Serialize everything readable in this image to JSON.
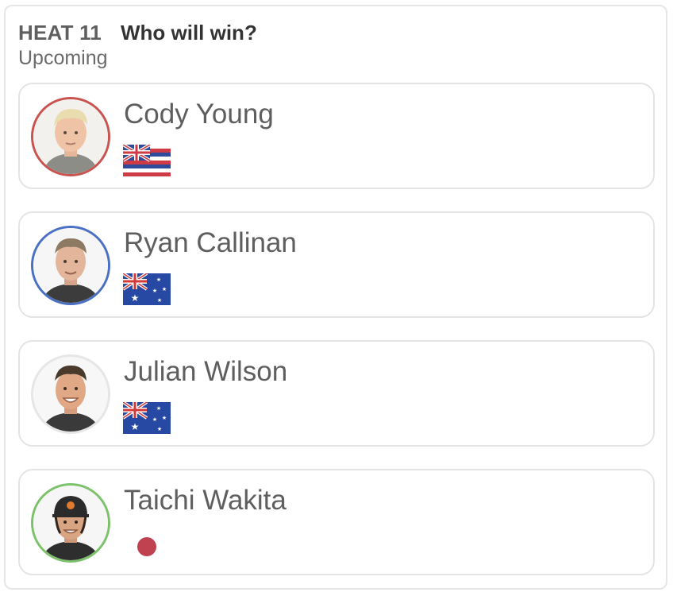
{
  "header": {
    "heat": "HEAT 11",
    "question": "Who will win?",
    "status": "Upcoming"
  },
  "surfers": [
    {
      "name": "Cody Young",
      "flag": "hawaii-flag",
      "ring_color": "#c9534f"
    },
    {
      "name": "Ryan Callinan",
      "flag": "australia-flag",
      "ring_color": "#4a70c4"
    },
    {
      "name": "Julian Wilson",
      "flag": "australia-flag",
      "ring_color": "#e6e6e6"
    },
    {
      "name": "Taichi Wakita",
      "flag": "japan-flag",
      "ring_color": "#7cc26a"
    }
  ]
}
